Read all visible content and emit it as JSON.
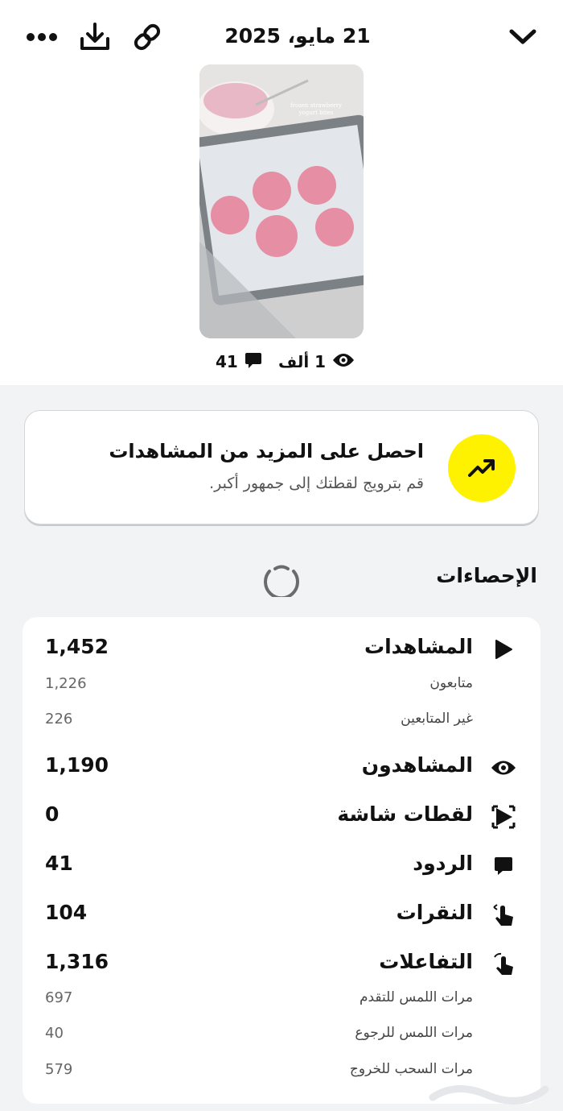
{
  "header": {
    "date": "21 مايو، 2025",
    "icons": [
      "chevron-down-icon",
      "link-icon",
      "download-icon",
      "more-icon"
    ]
  },
  "thumbnail": {
    "caption": "frozen strawberry yogurt bites"
  },
  "meta": {
    "views": "1 ألف",
    "replies": "41"
  },
  "promo": {
    "title": "احصل على المزيد من المشاهدات",
    "subtitle": "قم بترويج لقطتك إلى جمهور أكبر.",
    "icon": "trending-up-icon",
    "accent": "#fff200"
  },
  "stats": {
    "title": "الإحصاءات",
    "views": {
      "label": "المشاهدات",
      "value": "1,452"
    },
    "followers": {
      "label": "متابعون",
      "value": "1,226"
    },
    "non_followers": {
      "label": "غير المتابعين",
      "value": "226"
    },
    "viewers": {
      "label": "المشاهدون",
      "value": "1,190"
    },
    "screenshots": {
      "label": "لقطات شاشة",
      "value": "0"
    },
    "replies": {
      "label": "الردود",
      "value": "41"
    },
    "taps": {
      "label": "النقرات",
      "value": "104"
    },
    "interactions": {
      "label": "التفاعلات",
      "value": "1,316"
    },
    "forward_taps": {
      "label": "مرات اللمس للتقدم",
      "value": "697"
    },
    "back_taps": {
      "label": "مرات اللمس للرجوع",
      "value": "40"
    },
    "swipe_exits": {
      "label": "مرات السحب للخروج",
      "value": "579"
    }
  }
}
